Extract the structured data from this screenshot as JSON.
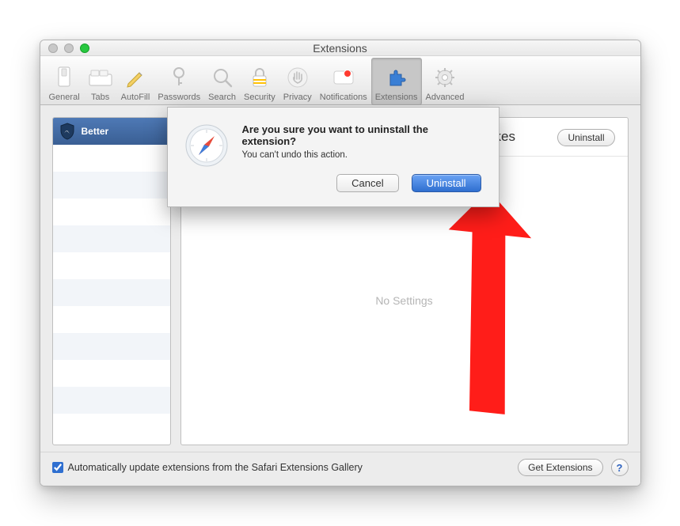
{
  "window": {
    "title": "Extensions"
  },
  "toolbar": {
    "items": [
      {
        "label": "General"
      },
      {
        "label": "Tabs"
      },
      {
        "label": "AutoFill"
      },
      {
        "label": "Passwords"
      },
      {
        "label": "Search"
      },
      {
        "label": "Security"
      },
      {
        "label": "Privacy"
      },
      {
        "label": "Notifications"
      },
      {
        "label": "Extensions"
      },
      {
        "label": "Advanced"
      }
    ]
  },
  "sidebar": {
    "extension_name": "Better"
  },
  "detail": {
    "header_text_partial": "kes",
    "uninstall_label": "Uninstall",
    "no_settings": "No Settings"
  },
  "footer": {
    "checkbox_label": "Automatically update extensions from the Safari Extensions Gallery",
    "get_extensions": "Get Extensions",
    "help": "?"
  },
  "dialog": {
    "heading": "Are you sure you want to uninstall the extension?",
    "body": "You can't undo this action.",
    "cancel_label": "Cancel",
    "confirm_label": "Uninstall"
  }
}
